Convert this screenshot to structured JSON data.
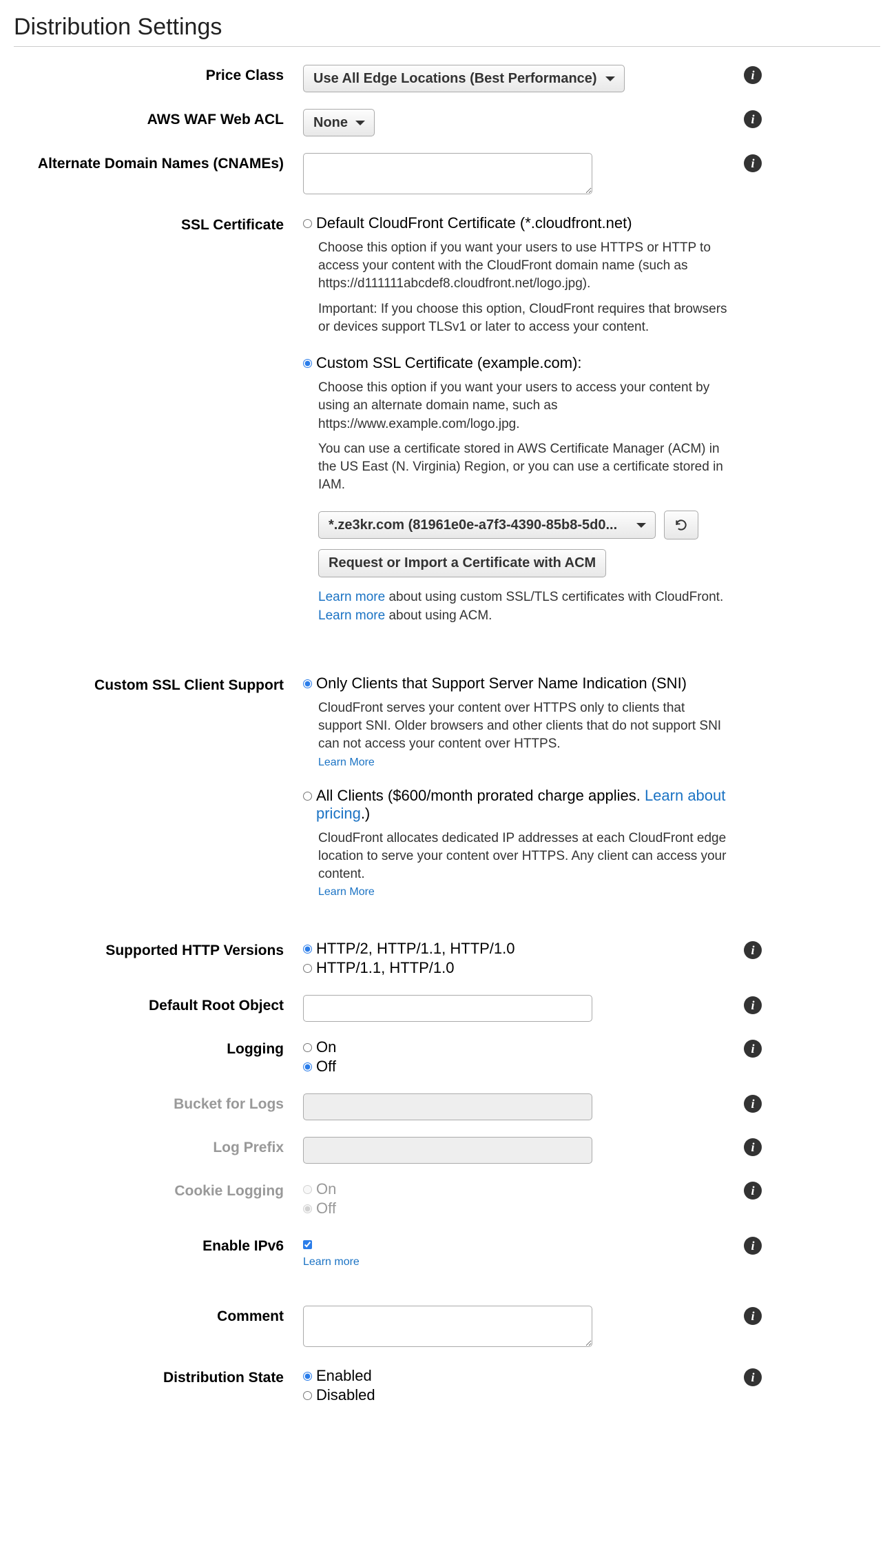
{
  "title": "Distribution Settings",
  "priceClass": {
    "label": "Price Class",
    "selected": "Use All Edge Locations (Best Performance)"
  },
  "wafAcl": {
    "label": "AWS WAF Web ACL",
    "selected": "None"
  },
  "cnames": {
    "label": "Alternate Domain Names (CNAMEs)"
  },
  "sslCert": {
    "label": "SSL Certificate",
    "defaultOpt": "Default CloudFront Certificate (*.cloudfront.net)",
    "defaultHelp1": "Choose this option if you want your users to use HTTPS or HTTP to access your content with the CloudFront domain name (such as https://d111111abcdef8.cloudfront.net/logo.jpg).",
    "defaultHelp2": "Important: If you choose this option, CloudFront requires that browsers or devices support TLSv1 or later to access your content.",
    "customOpt": "Custom SSL Certificate (example.com):",
    "customHelp1": "Choose this option if you want your users to access your content by using an alternate domain name, such as https://www.example.com/logo.jpg.",
    "customHelp2": "You can use a certificate stored in AWS Certificate Manager (ACM) in the US East (N. Virginia) Region, or you can use a certificate stored in IAM.",
    "certSelected": "*.ze3kr.com (81961e0e-a7f3-4390-85b8-5d0...",
    "acmBtn": "Request or Import a Certificate with ACM",
    "learnMore1a": "Learn more",
    "learnMore1b": " about using custom SSL/TLS certificates with CloudFront.",
    "learnMore2a": "Learn more",
    "learnMore2b": " about using ACM."
  },
  "sslClient": {
    "label": "Custom SSL Client Support",
    "sniOpt": "Only Clients that Support Server Name Indication (SNI)",
    "sniHelp": "CloudFront serves your content over HTTPS only to clients that support SNI. Older browsers and other clients that do not support SNI can not access your content over HTTPS.",
    "sniLearn": "Learn More",
    "allOptPrefix": "All Clients ($600/month prorated charge applies. ",
    "allOptLink": "Learn about pricing",
    "allOptSuffix": ".)",
    "allHelp": "CloudFront allocates dedicated IP addresses at each CloudFront edge location to serve your content over HTTPS. Any client can access your content.",
    "allLearn": "Learn More"
  },
  "httpVer": {
    "label": "Supported HTTP Versions",
    "opt1": "HTTP/2, HTTP/1.1, HTTP/1.0",
    "opt2": "HTTP/1.1, HTTP/1.0"
  },
  "rootObj": {
    "label": "Default Root Object"
  },
  "logging": {
    "label": "Logging",
    "on": "On",
    "off": "Off"
  },
  "bucketLogs": {
    "label": "Bucket for Logs"
  },
  "logPrefix": {
    "label": "Log Prefix"
  },
  "cookieLog": {
    "label": "Cookie Logging",
    "on": "On",
    "off": "Off"
  },
  "ipv6": {
    "label": "Enable IPv6",
    "learn": "Learn more"
  },
  "comment": {
    "label": "Comment"
  },
  "distState": {
    "label": "Distribution State",
    "enabled": "Enabled",
    "disabled": "Disabled"
  }
}
